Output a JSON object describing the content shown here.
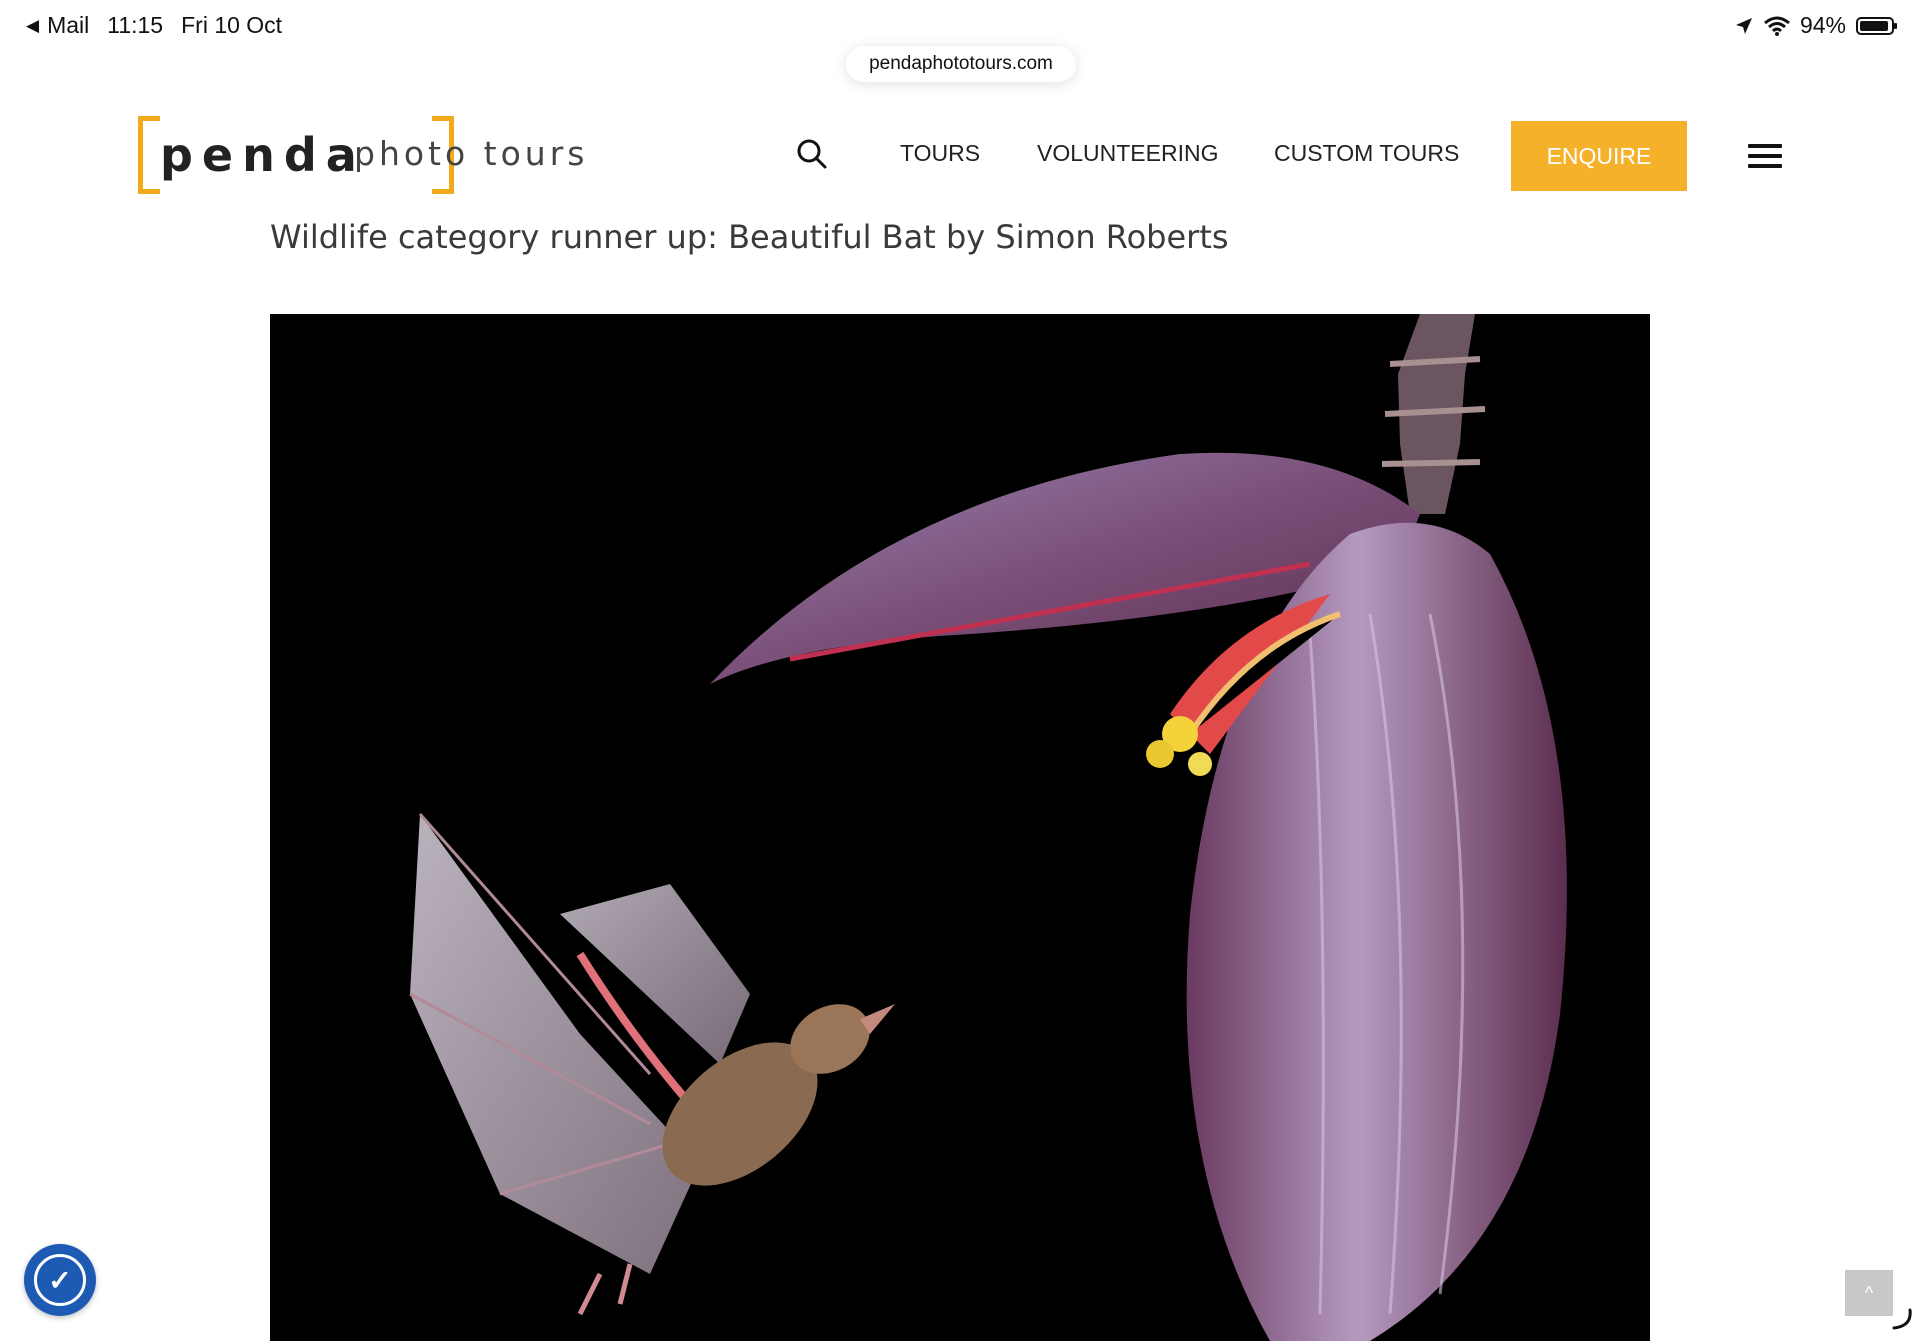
{
  "status_bar": {
    "back_app": "Mail",
    "time": "11:15",
    "date": "Fri 10 Oct",
    "battery": "94%"
  },
  "browser": {
    "url": "pendaphototours.com"
  },
  "brand": {
    "logo_main": "penda",
    "logo_sub": "photo tours",
    "accent_color": "#f5b12a"
  },
  "nav": {
    "items": [
      "TOURS",
      "VOLUNTEERING",
      "CUSTOM TOURS"
    ],
    "cta": "ENQUIRE",
    "search_icon": "search-icon",
    "menu_icon": "hamburger-menu-icon"
  },
  "article": {
    "headline": "Wildlife category runner up: Beautiful Bat by Simon Roberts"
  },
  "widgets": {
    "accessibility_icon": "accessibility-icon",
    "scroll_top_icon": "chevron-up-icon",
    "scroll_top_glyph": "^"
  }
}
